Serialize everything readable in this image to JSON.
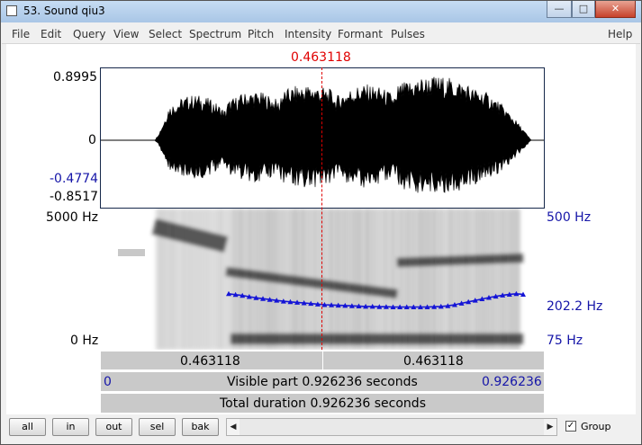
{
  "window": {
    "title": "53. Sound qiu3"
  },
  "window_controls": {
    "minimize": "—",
    "maximize": "□",
    "close": "✕"
  },
  "menu": [
    "File",
    "Edit",
    "Query",
    "View",
    "Select",
    "Spectrum",
    "Pitch",
    "Intensity",
    "Formant",
    "Pulses"
  ],
  "help_label": "Help",
  "cursor": {
    "time_label": "0.463118",
    "time": 0.463118
  },
  "waveform": {
    "y_max": "0.8995",
    "y_zero": "0",
    "y_min_visible": "-0.4774",
    "y_min": "-0.8517"
  },
  "spectrogram": {
    "freq_max_label": "5000 Hz",
    "freq_min_label": "0 Hz"
  },
  "pitch": {
    "max_label": "500 Hz",
    "mid_label": "202.2 Hz",
    "min_label": "75 Hz",
    "range_hz": [
      75,
      500
    ],
    "track_hz": [
      235,
      232,
      229,
      225,
      221,
      218,
      215,
      212,
      209,
      207,
      205,
      203,
      201,
      199,
      197,
      196,
      195,
      194,
      193,
      192,
      191,
      191,
      190,
      190,
      189,
      189,
      189,
      189,
      189,
      189,
      190,
      191,
      193,
      197,
      202,
      207,
      212,
      217,
      222,
      226,
      230,
      233,
      235,
      233
    ]
  },
  "duration": {
    "total": 0.926236
  },
  "time_panel": {
    "left": "0.463118",
    "right": "0.463118"
  },
  "visible_panel": {
    "start": "0",
    "text": "Visible part 0.926236 seconds",
    "end": "0.926236"
  },
  "total_panel": {
    "text": "Total duration 0.926236 seconds"
  },
  "buttons": {
    "all": "all",
    "in": "in",
    "out": "out",
    "sel": "sel",
    "bak": "bak"
  },
  "scroll": {
    "left_arrow": "◀",
    "right_arrow": "▶"
  },
  "group": {
    "label": "Group",
    "checked": true,
    "check_mark": "✓"
  },
  "colors": {
    "cursor": "#e00000",
    "pitch": "#1515d6",
    "axis_blue": "#1515a8",
    "frame": "#16284a"
  }
}
